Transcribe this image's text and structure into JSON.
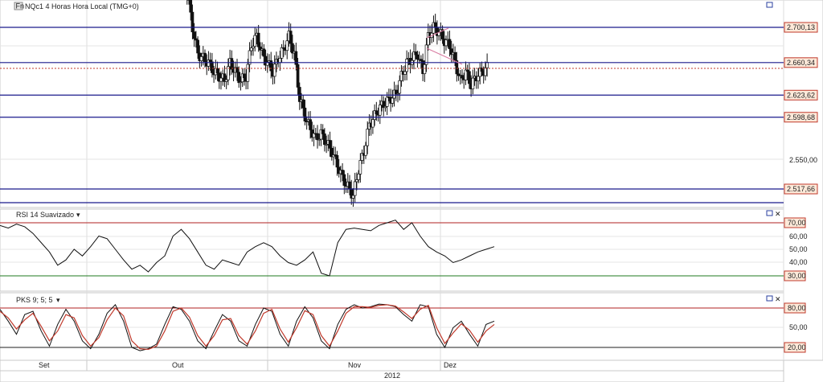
{
  "header": {
    "symbol_icon": "chart-icon",
    "title": "NQc1 4 Horas Hora Local (TMG+0)"
  },
  "colors": {
    "grid": "#dcdcdc",
    "hline_blue": "#1a1a8c",
    "rsi_upper": "#b22222",
    "rsi_lower": "#1f7a1f",
    "pks_line": "#b22222",
    "candle": "#111111",
    "label_bg_red": "#fde9d9",
    "label_border_red": "#c0392b"
  },
  "price_panel": {
    "price_labels": [
      "2.700,13",
      "2.660,34",
      "2.623,62",
      "2.598,68",
      "2.517,66"
    ],
    "scale_tick": "2.550,00",
    "current_label": "2.6xx"
  },
  "rsi_panel": {
    "title": "RSI 14 Suavizado",
    "dropdown_icon": "chevron-down-icon",
    "upper_label": "70,00",
    "lower_label": "30,00",
    "ticks": [
      "60,00",
      "50,00",
      "40,00"
    ]
  },
  "pks_panel": {
    "title": "PKS 9; 5; 5",
    "dropdown_icon": "chevron-down-icon",
    "upper_label": "80,00",
    "lower_label": "20,00",
    "ticks": [
      "50,00"
    ]
  },
  "time_axis": {
    "months": [
      "Set",
      "Out",
      "Nov",
      "Dez"
    ],
    "year": "2012"
  },
  "chart_data": [
    {
      "type": "candlestick",
      "title": "NQc1 4 Horas Hora Local (TMG+0)",
      "horizontal_levels": [
        2700.13,
        2660.34,
        2623.62,
        2598.68,
        2517.66
      ],
      "y_tick": 2550.0,
      "x_ticks": [
        "Set",
        "Out",
        "Nov",
        "Dez"
      ],
      "close_path": [
        2790,
        2785,
        2780,
        2770,
        2782,
        2776,
        2770,
        2775,
        2760,
        2740,
        2700,
        2670,
        2665,
        2660,
        2650,
        2645,
        2640,
        2660,
        2650,
        2640,
        2645,
        2680,
        2690,
        2670,
        2660,
        2650,
        2665,
        2675,
        2690,
        2670,
        2620,
        2600,
        2585,
        2575,
        2580,
        2570,
        2560,
        2545,
        2530,
        2520,
        2510,
        2540,
        2560,
        2590,
        2600,
        2610,
        2615,
        2620,
        2625,
        2645,
        2660,
        2665,
        2670,
        2650,
        2690,
        2700,
        2695,
        2685,
        2680,
        2660,
        2640,
        2650,
        2635,
        2645,
        2650,
        2655
      ]
    },
    {
      "type": "line",
      "title": "RSI 14 Suavizado",
      "levels": [
        70,
        30
      ],
      "y_ticks": [
        60,
        50,
        40
      ],
      "values": [
        68,
        66,
        69,
        67,
        62,
        55,
        48,
        38,
        42,
        50,
        45,
        52,
        60,
        58,
        50,
        42,
        35,
        38,
        33,
        40,
        45,
        60,
        65,
        58,
        48,
        38,
        35,
        42,
        40,
        38,
        48,
        52,
        55,
        52,
        45,
        40,
        38,
        42,
        48,
        32,
        30,
        55,
        65,
        66,
        65,
        64,
        68,
        70,
        72,
        65,
        70,
        60,
        52,
        48,
        45,
        40,
        42,
        45,
        48,
        50,
        52
      ]
    },
    {
      "type": "line",
      "title": "PKS 9; 5; 5",
      "levels": [
        80,
        20
      ],
      "y_ticks": [
        50
      ],
      "series": [
        {
          "values": [
            78,
            60,
            40,
            70,
            75,
            45,
            22,
            55,
            78,
            60,
            30,
            18,
            40,
            72,
            85,
            60,
            20,
            15,
            18,
            25,
            55,
            82,
            78,
            60,
            30,
            18,
            45,
            70,
            60,
            30,
            22,
            55,
            80,
            75,
            40,
            22,
            60,
            82,
            65,
            30,
            18,
            55,
            78,
            85,
            80,
            82,
            86,
            85,
            82,
            70,
            60,
            85,
            82,
            40,
            20,
            50,
            60,
            40,
            22,
            55,
            60
          ]
        },
        {
          "values": [
            75,
            65,
            48,
            62,
            72,
            52,
            30,
            45,
            70,
            65,
            38,
            22,
            35,
            62,
            80,
            68,
            30,
            18,
            17,
            22,
            45,
            75,
            80,
            66,
            38,
            22,
            38,
            62,
            64,
            38,
            25,
            45,
            72,
            78,
            48,
            28,
            50,
            76,
            70,
            38,
            22,
            45,
            72,
            82,
            82,
            81,
            84,
            85,
            83,
            74,
            64,
            78,
            84,
            50,
            26,
            42,
            56,
            46,
            28,
            45,
            55
          ]
        }
      ]
    }
  ]
}
